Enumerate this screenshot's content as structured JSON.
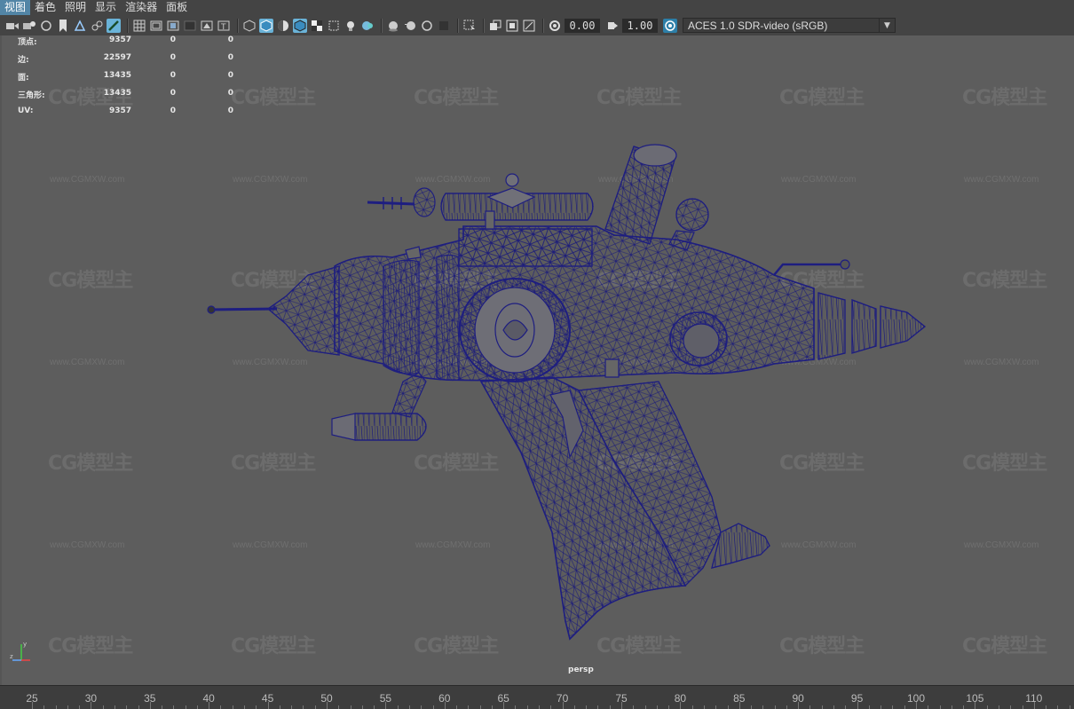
{
  "menu": [
    "视图",
    "着色",
    "照明",
    "显示",
    "渲染器",
    "面板"
  ],
  "toolbar": {
    "exposure": "0.00",
    "gamma": "1.00",
    "colorspace": "ACES 1.0 SDR-video (sRGB)",
    "icons": [
      "camera-icon",
      "camera-attr-icon",
      "bookmark-icon",
      "image-plane-icon",
      "grid-view-icon",
      "film-gate-icon",
      "resolution-gate-icon",
      "gate-mask-icon",
      "field-chart-icon",
      "safe-action-icon",
      "wireframe-icon",
      "smooth-shade-icon",
      "default-material-icon",
      "wireframe-on-shaded-icon",
      "xray-icon",
      "texture-icon",
      "lights-icon",
      "shadows-icon",
      "ssao-icon",
      "motion-blur-icon",
      "aa-icon",
      "isolate-icon",
      "xray-joints-icon",
      "xray-active-icon",
      "backface-icon",
      "exposure-icon",
      "gamma-icon",
      "color-mgmt-icon"
    ]
  },
  "hud": [
    {
      "label": "顶点:",
      "v1": "9357",
      "v2": "0",
      "v3": "0"
    },
    {
      "label": "边:",
      "v1": "22597",
      "v2": "0",
      "v3": "0"
    },
    {
      "label": "面:",
      "v1": "13435",
      "v2": "0",
      "v3": "0"
    },
    {
      "label": "三角形:",
      "v1": "13435",
      "v2": "0",
      "v3": "0"
    },
    {
      "label": "UV:",
      "v1": "9357",
      "v2": "0",
      "v3": "0"
    }
  ],
  "viewport": {
    "camera": "persp"
  },
  "watermark": {
    "logo": "CG模型主",
    "url": "www.CGMXW.com"
  },
  "timeline": {
    "ticks": [
      "25",
      "30",
      "35",
      "40",
      "45",
      "50",
      "55",
      "60",
      "65",
      "70",
      "75",
      "80",
      "85",
      "90",
      "95",
      "100",
      "105",
      "110"
    ]
  }
}
